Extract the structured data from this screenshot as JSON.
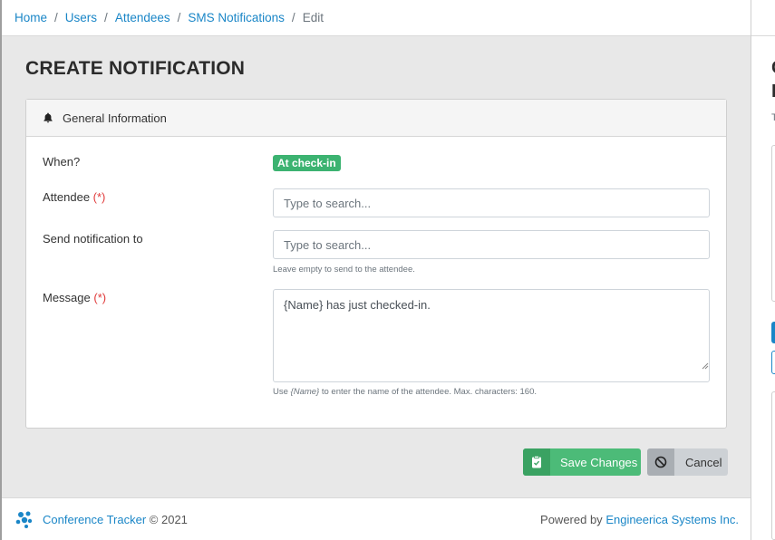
{
  "breadcrumb": {
    "items": [
      "Home",
      "Users",
      "Attendees",
      "SMS Notifications"
    ],
    "separator": "/",
    "current": "Edit"
  },
  "page": {
    "title": "CREATE NOTIFICATION"
  },
  "card": {
    "header": "General Information",
    "icon": "bell-icon"
  },
  "form": {
    "when_label": "When?",
    "when_value": "At check-in",
    "attendee_label": "Attendee",
    "required_mark": "(*)",
    "attendee_placeholder": "Type to search...",
    "send_to_label": "Send notification to",
    "send_to_placeholder": "Type to search...",
    "send_to_help": "Leave empty to send to the attendee.",
    "message_label": "Message",
    "message_value": "{Name} has just checked-in.",
    "message_help_prefix": "Use",
    "message_help_token": "{Name}",
    "message_help_suffix": "to enter the name of the attendee. Max. characters: 160."
  },
  "buttons": {
    "save": "Save Changes",
    "cancel": "Cancel"
  },
  "footer": {
    "app_name": "Conference Tracker",
    "copyright": "© 2021",
    "powered_prefix": "Powered by",
    "powered_link": "Engineerica Systems Inc."
  },
  "colors": {
    "link": "#1a86c7",
    "success": "#4cbb78",
    "badge": "#3cb371",
    "required": "#e03a3a",
    "secondary": "#cdd1d5"
  }
}
